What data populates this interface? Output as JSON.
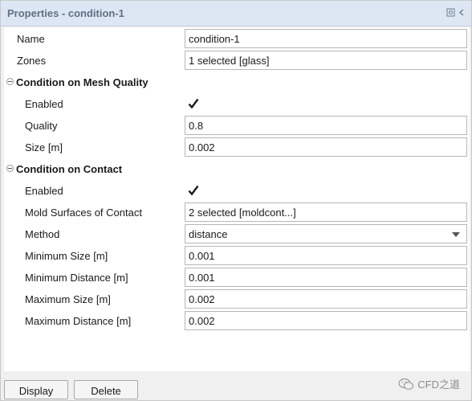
{
  "panel": {
    "title": "Properties - condition-1",
    "icons": [
      "pin-icon",
      "collapse-panel-icon"
    ]
  },
  "props": {
    "name": {
      "label": "Name",
      "value": "condition-1"
    },
    "zones": {
      "label": "Zones",
      "value": "1 selected [glass]"
    }
  },
  "mesh_quality": {
    "title": "Condition on Mesh Quality",
    "enabled": {
      "label": "Enabled",
      "checked": true
    },
    "quality": {
      "label": "Quality",
      "value": "0.8"
    },
    "size": {
      "label": "Size [m]",
      "value": "0.002"
    }
  },
  "contact": {
    "title": "Condition on Contact",
    "enabled": {
      "label": "Enabled",
      "checked": true
    },
    "mold_surfaces": {
      "label": "Mold Surfaces of Contact",
      "value": "2 selected [moldcont...]"
    },
    "method": {
      "label": "Method",
      "value": "distance"
    },
    "min_size": {
      "label": "Minimum Size [m]",
      "value": "0.001"
    },
    "min_distance": {
      "label": "Minimum Distance [m]",
      "value": "0.001"
    },
    "max_size": {
      "label": "Maximum Size [m]",
      "value": "0.002"
    },
    "max_distance": {
      "label": "Maximum Distance [m]",
      "value": "0.002"
    }
  },
  "buttons": {
    "display": "Display",
    "delete": "Delete"
  },
  "watermark": {
    "text": "CFD之道",
    "icon": "wechat-icon"
  },
  "colors": {
    "title_bg": "#dde6f3",
    "title_text": "#5f7184",
    "panel_bg": "#f0f0f0"
  }
}
